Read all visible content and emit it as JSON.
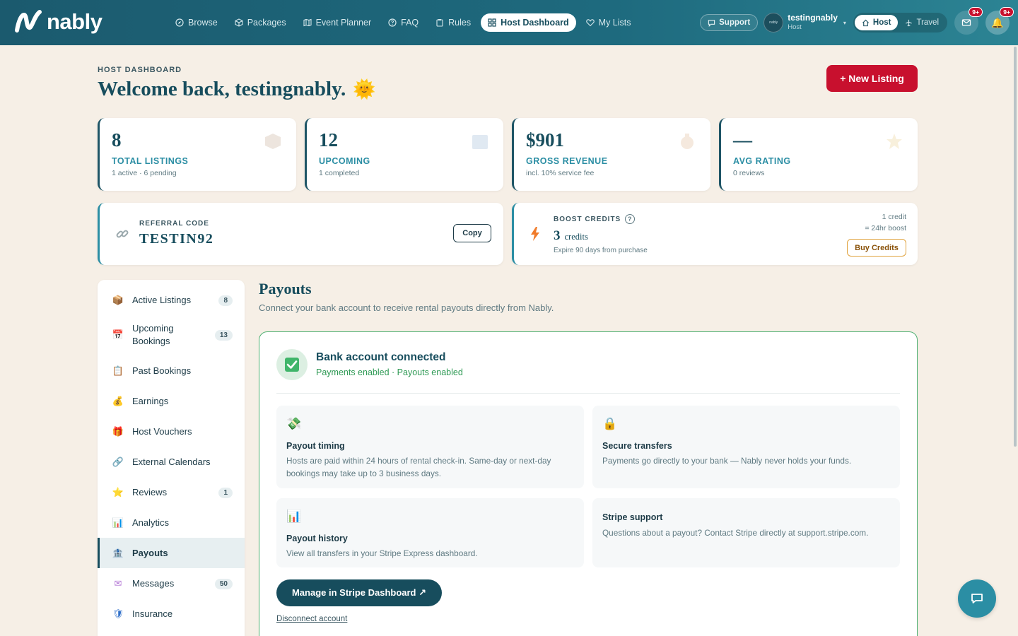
{
  "brand": {
    "name": "nably"
  },
  "nav": {
    "links": [
      {
        "label": "Browse",
        "icon": "compass-icon"
      },
      {
        "label": "Packages",
        "icon": "box-icon"
      },
      {
        "label": "Event Planner",
        "icon": "map-icon"
      },
      {
        "label": "FAQ",
        "icon": "help-circle-icon"
      },
      {
        "label": "Rules",
        "icon": "clipboard-icon"
      },
      {
        "label": "Host Dashboard",
        "icon": "grid-icon",
        "active": true
      },
      {
        "label": "My Lists",
        "icon": "heart-icon"
      }
    ],
    "support_label": "Support",
    "user": {
      "name": "testingnably",
      "role": "Host",
      "avatar_text": "nably"
    },
    "mode": {
      "host_label": "Host",
      "travel_label": "Travel",
      "active": "Host"
    },
    "messages_badge": "9+",
    "notifications_badge": "9+"
  },
  "header": {
    "eyebrow": "HOST DASHBOARD",
    "welcome": "Welcome back, testingnably.",
    "welcome_emoji": "🌞",
    "new_listing_label": "+ New Listing"
  },
  "stats": [
    {
      "value": "8",
      "label": "TOTAL LISTINGS",
      "sub": "1 active · 6 pending",
      "icon": "box-icon"
    },
    {
      "value": "12",
      "label": "UPCOMING",
      "sub": "1 completed",
      "icon": "calendar-icon"
    },
    {
      "value": "$901",
      "label": "GROSS REVENUE",
      "sub": "incl. 10% service fee",
      "icon": "money-bag-icon"
    },
    {
      "value": "—",
      "label": "AVG RATING",
      "sub": "0 reviews",
      "icon": "star-icon"
    }
  ],
  "referral": {
    "label": "REFERRAL CODE",
    "code": "TESTIN92",
    "copy_label": "Copy"
  },
  "boost": {
    "label": "BOOST CREDITS",
    "value": "3",
    "unit": "credits",
    "sub": "Expire 90 days from purchase",
    "rate_line1": "1 credit",
    "rate_line2": "= 24hr boost",
    "buy_label": "Buy Credits"
  },
  "sidebar": {
    "items": [
      {
        "label": "Active Listings",
        "icon": "📦",
        "count": "8"
      },
      {
        "label": "Upcoming Bookings",
        "icon": "📅",
        "count": "13"
      },
      {
        "label": "Past Bookings",
        "icon": "📋",
        "count": ""
      },
      {
        "label": "Earnings",
        "icon": "💰",
        "count": ""
      },
      {
        "label": "Host Vouchers",
        "icon": "🎁",
        "count": ""
      },
      {
        "label": "External Calendars",
        "icon": "🔗",
        "count": ""
      },
      {
        "label": "Reviews",
        "icon": "⭐",
        "count": "1"
      },
      {
        "label": "Analytics",
        "icon": "📊",
        "count": ""
      },
      {
        "label": "Payouts",
        "icon": "🏦",
        "count": "",
        "active": true
      },
      {
        "label": "Messages",
        "icon": "✉",
        "count": "50"
      },
      {
        "label": "Insurance",
        "icon": "🛡",
        "count": ""
      }
    ]
  },
  "main": {
    "title": "Payouts",
    "subtitle": "Connect your bank account to receive rental payouts directly from Nably.",
    "bank": {
      "title": "Bank account connected",
      "status": "Payments enabled · Payouts enabled"
    },
    "tiles": [
      {
        "icon": "💸",
        "title": "Payout timing",
        "text": "Hosts are paid within 24 hours of rental check-in. Same-day or next-day bookings may take up to 3 business days."
      },
      {
        "icon": "🔒",
        "title": "Secure transfers",
        "text": "Payments go directly to your bank — Nably never holds your funds."
      },
      {
        "icon": "📊",
        "title": "Payout history",
        "text": "View all transfers in your Stripe Express dashboard."
      },
      {
        "icon": "",
        "title": "Stripe support",
        "text": "Questions about a payout? Contact Stripe directly at support.stripe.com."
      }
    ],
    "stripe_button_label": "Manage in Stripe Dashboard ↗",
    "disconnect_label": "Disconnect account"
  },
  "colors": {
    "brand": "#174d5d",
    "accent": "#2b8ea4",
    "danger": "#c8102e",
    "success": "#2f9a55",
    "background": "#f6efe6"
  }
}
